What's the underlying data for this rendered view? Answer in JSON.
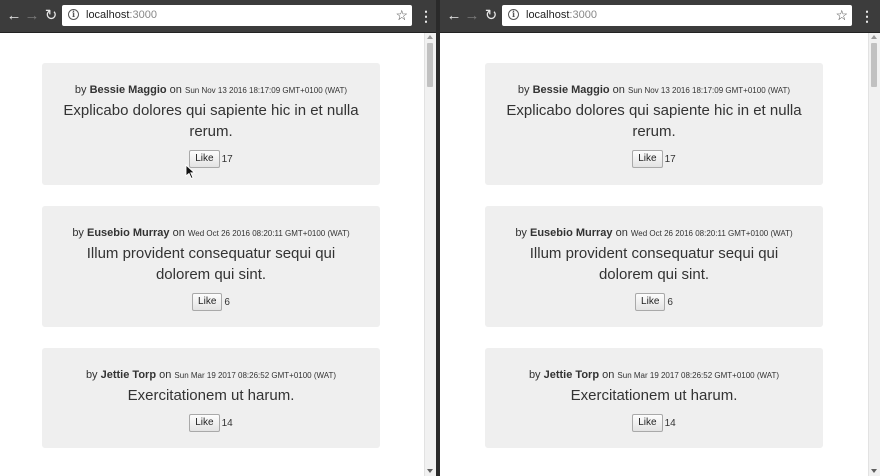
{
  "windows": [
    {
      "id": "left",
      "url_host": "localhost",
      "url_port": ":3000",
      "posts": [
        {
          "prefix": "by ",
          "author": "Bessie Maggio",
          "on": " on ",
          "date": "Sun Nov 13 2016 18:17:09 GMT+0100 (WAT)",
          "title": "Explicabo dolores qui sapiente hic in et nulla rerum.",
          "like_label": "Like",
          "likes": "17"
        },
        {
          "prefix": "by ",
          "author": "Eusebio Murray",
          "on": " on ",
          "date": "Wed Oct 26 2016 08:20:11 GMT+0100 (WAT)",
          "title": "Illum provident consequatur sequi qui dolorem qui sint.",
          "like_label": "Like",
          "likes": "6"
        },
        {
          "prefix": "by ",
          "author": "Jettie Torp",
          "on": " on ",
          "date": "Sun Mar 19 2017 08:26:52 GMT+0100 (WAT)",
          "title": "Exercitationem ut harum.",
          "like_label": "Like",
          "likes": "14"
        }
      ]
    },
    {
      "id": "right",
      "url_host": "localhost",
      "url_port": ":3000",
      "posts": [
        {
          "prefix": "by ",
          "author": "Bessie Maggio",
          "on": " on ",
          "date": "Sun Nov 13 2016 18:17:09 GMT+0100 (WAT)",
          "title": "Explicabo dolores qui sapiente hic in et nulla rerum.",
          "like_label": "Like",
          "likes": "17"
        },
        {
          "prefix": "by ",
          "author": "Eusebio Murray",
          "on": " on ",
          "date": "Wed Oct 26 2016 08:20:11 GMT+0100 (WAT)",
          "title": "Illum provident consequatur sequi qui dolorem qui sint.",
          "like_label": "Like",
          "likes": "6"
        },
        {
          "prefix": "by ",
          "author": "Jettie Torp",
          "on": " on ",
          "date": "Sun Mar 19 2017 08:26:52 GMT+0100 (WAT)",
          "title": "Exercitationem ut harum.",
          "like_label": "Like",
          "likes": "14"
        }
      ]
    }
  ],
  "icons": {
    "back": "arrow-left-icon",
    "forward": "arrow-right-icon",
    "reload": "reload-icon",
    "info": "info-icon",
    "bookmark": "star-icon",
    "menu": "kebab-menu-icon"
  }
}
